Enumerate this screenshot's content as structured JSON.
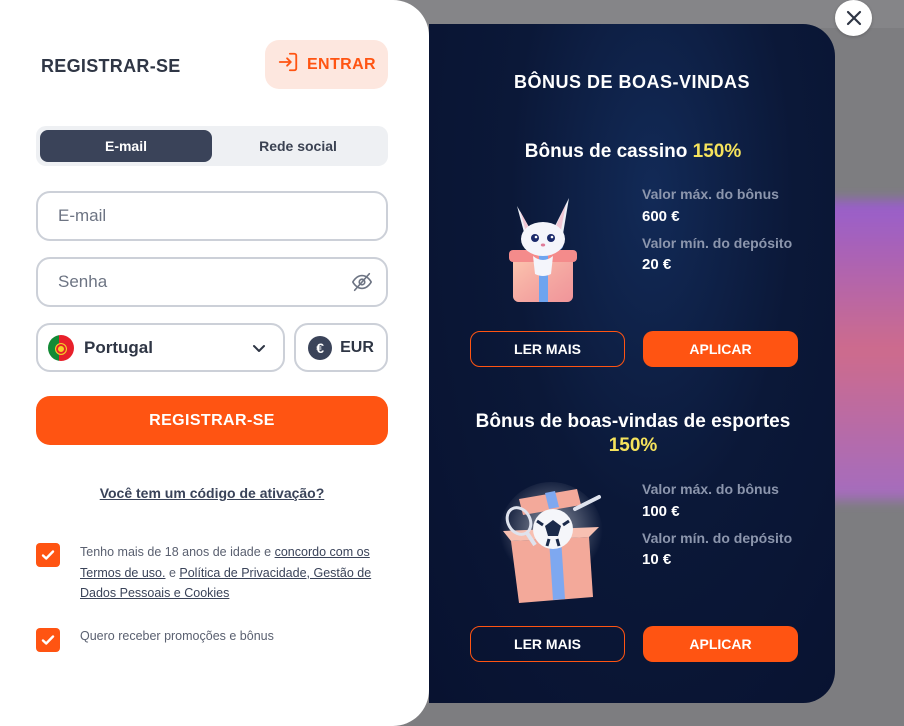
{
  "register_form": {
    "title": "REGISTRAR-SE",
    "login_button": "ENTRAR",
    "tabs": [
      {
        "label": "E-mail",
        "active": true
      },
      {
        "label": "Rede social",
        "active": false
      }
    ],
    "email_placeholder": "E-mail",
    "password_placeholder": "Senha",
    "country": "Portugal",
    "currency": "EUR",
    "currency_symbol": "€",
    "submit_button": "REGISTRAR-SE",
    "activation_link": "Você tem um código de ativação?",
    "terms": {
      "checked": true,
      "prefix": "Tenho mais de 18 anos de idade e ",
      "link_agree": "concordo com os Termos de uso.",
      "middle": " e ",
      "link_privacy": "Política de Privacidade, Gestão de Dados Pessoais e Cookies"
    },
    "promo": {
      "checked": true,
      "text": "Quero receber promoções e bônus"
    }
  },
  "bonus_panel": {
    "heading": "BÔNUS DE BOAS-VINDAS",
    "bonuses": [
      {
        "title": "Bônus de cassino",
        "percent": "150%",
        "max_label": "Valor máx. do bônus",
        "max_value": "600 €",
        "min_label": "Valor mín. do depósito",
        "min_value": "20 €",
        "read_more": "LER MAIS",
        "apply": "APLICAR",
        "image": "fox-gift-icon"
      },
      {
        "title": "Bônus de boas-vindas de esportes",
        "percent": "150%",
        "max_label": "Valor máx. do bônus",
        "max_value": "100 €",
        "min_label": "Valor mín. do depósito",
        "min_value": "10 €",
        "read_more": "LER MAIS",
        "apply": "APLICAR",
        "image": "sports-gift-icon"
      }
    ]
  },
  "colors": {
    "accent": "#ff5412",
    "dark_panel": "#0b1838",
    "highlight": "#f6e35c",
    "tab_active": "#3a4359"
  }
}
